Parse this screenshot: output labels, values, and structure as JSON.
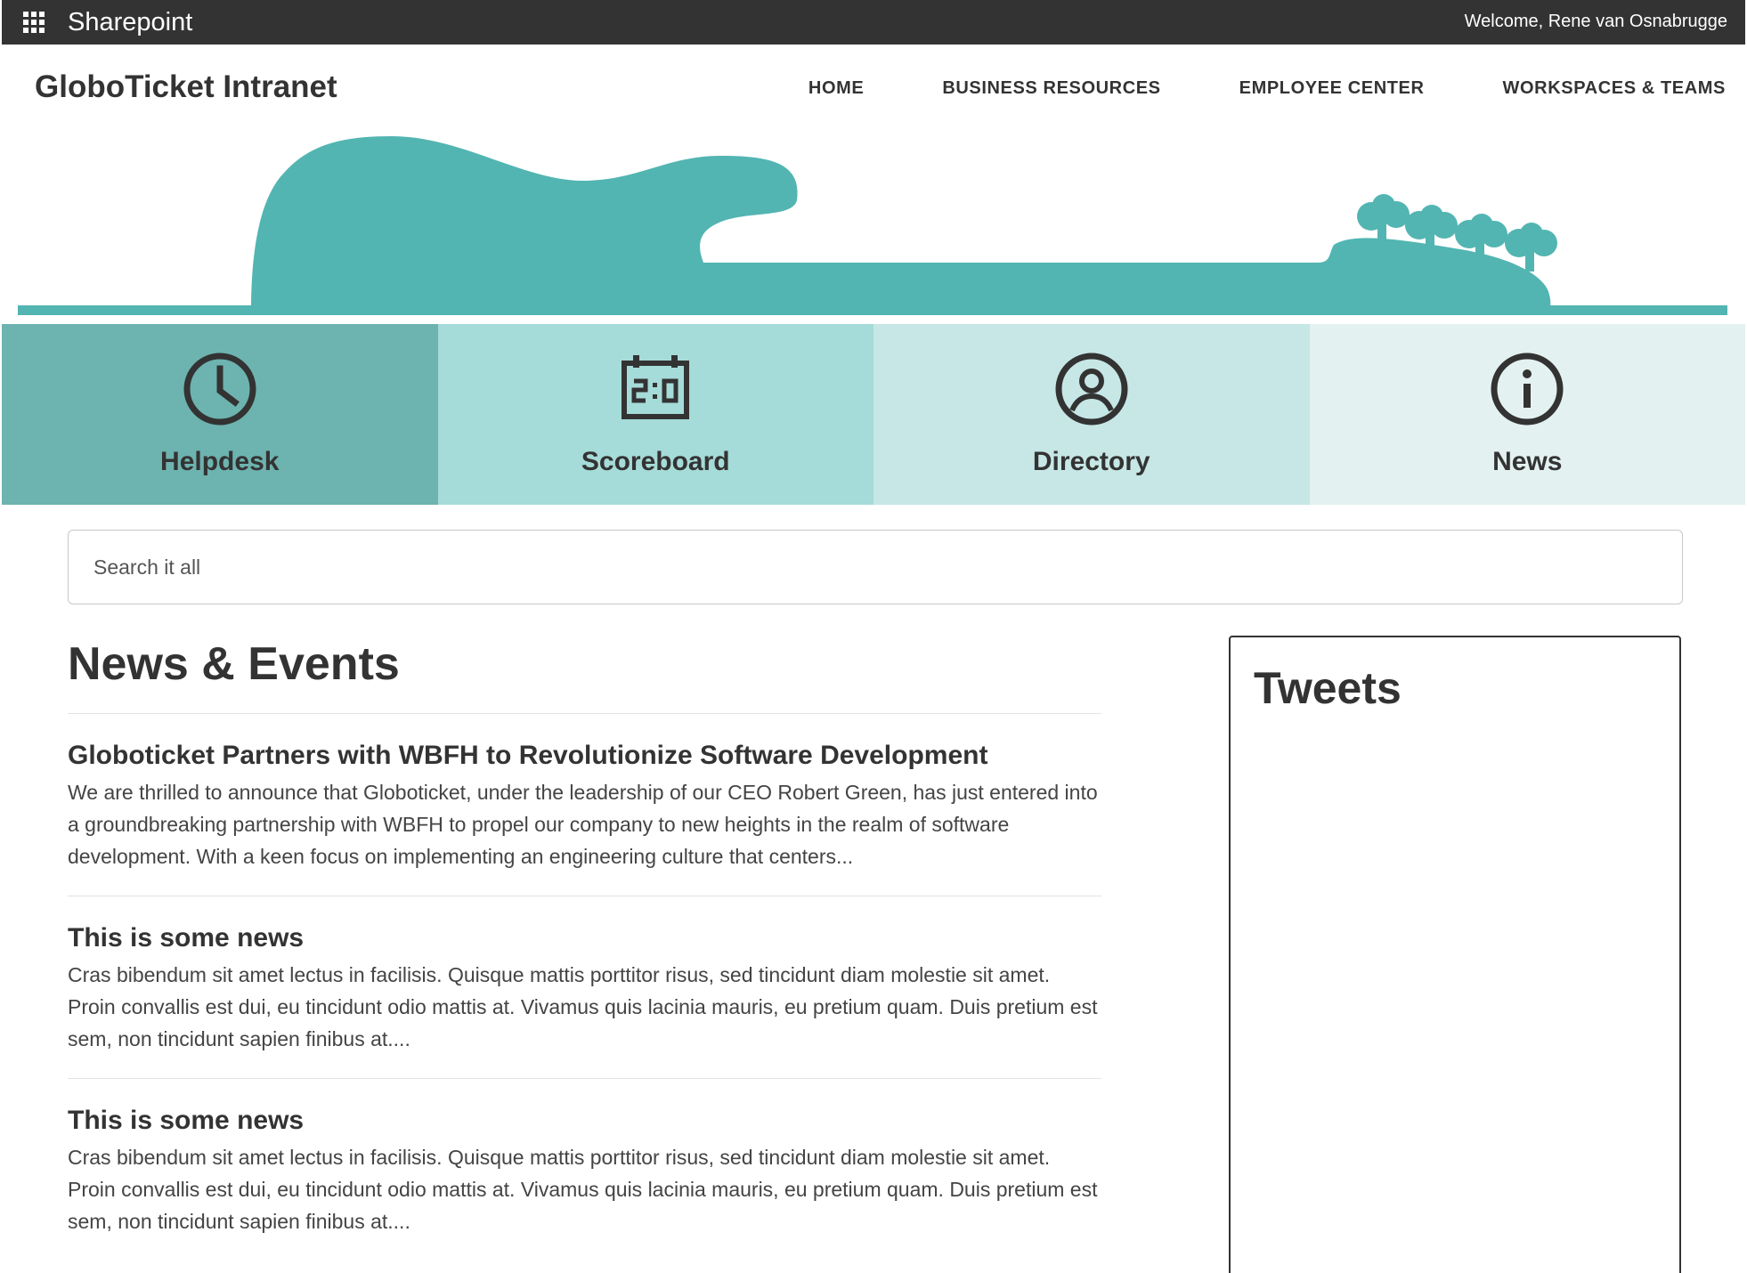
{
  "suite": {
    "title": "Sharepoint",
    "welcome": "Welcome, Rene van Osnabrugge"
  },
  "site": {
    "title": "GloboTicket Intranet"
  },
  "nav": {
    "items": [
      {
        "label": "HOME"
      },
      {
        "label": "BUSINESS RESOURCES"
      },
      {
        "label": "EMPLOYEE CENTER"
      },
      {
        "label": "WORKSPACES & TEAMS"
      }
    ]
  },
  "tiles": [
    {
      "label": "Helpdesk",
      "icon": "clock-icon",
      "color": "#6db3af"
    },
    {
      "label": "Scoreboard",
      "icon": "scoreboard-icon",
      "color": "#a5dbd8"
    },
    {
      "label": "Directory",
      "icon": "person-icon",
      "color": "#c6e7e5"
    },
    {
      "label": "News",
      "icon": "info-icon",
      "color": "#e3f1f0"
    }
  ],
  "search": {
    "placeholder": "Search it all"
  },
  "news": {
    "heading": "News & Events",
    "items": [
      {
        "title": "Globoticket Partners with WBFH to Revolutionize Software Development",
        "body": "We are thrilled to announce that Globoticket, under the leadership of our CEO Robert Green, has just entered into a groundbreaking partnership with WBFH to propel our company to new heights in the realm of software development. With a keen focus on implementing an engineering culture that centers..."
      },
      {
        "title": "This is some news",
        "body": "Cras bibendum sit amet lectus in facilisis. Quisque mattis porttitor risus, sed tincidunt diam molestie sit amet. Proin convallis est dui, eu tincidunt odio mattis at. Vivamus quis lacinia mauris, eu pretium quam. Duis pretium est sem, non tincidunt sapien finibus at...."
      },
      {
        "title": "This is some news",
        "body": "Cras bibendum sit amet lectus in facilisis. Quisque mattis porttitor risus, sed tincidunt diam molestie sit amet. Proin convallis est dui, eu tincidunt odio mattis at. Vivamus quis lacinia mauris, eu pretium quam. Duis pretium est sem, non tincidunt sapien finibus at...."
      }
    ]
  },
  "tweets": {
    "heading": "Tweets"
  },
  "colors": {
    "accent": "#52b5b2",
    "suitebar": "#333333",
    "text": "#333333"
  }
}
